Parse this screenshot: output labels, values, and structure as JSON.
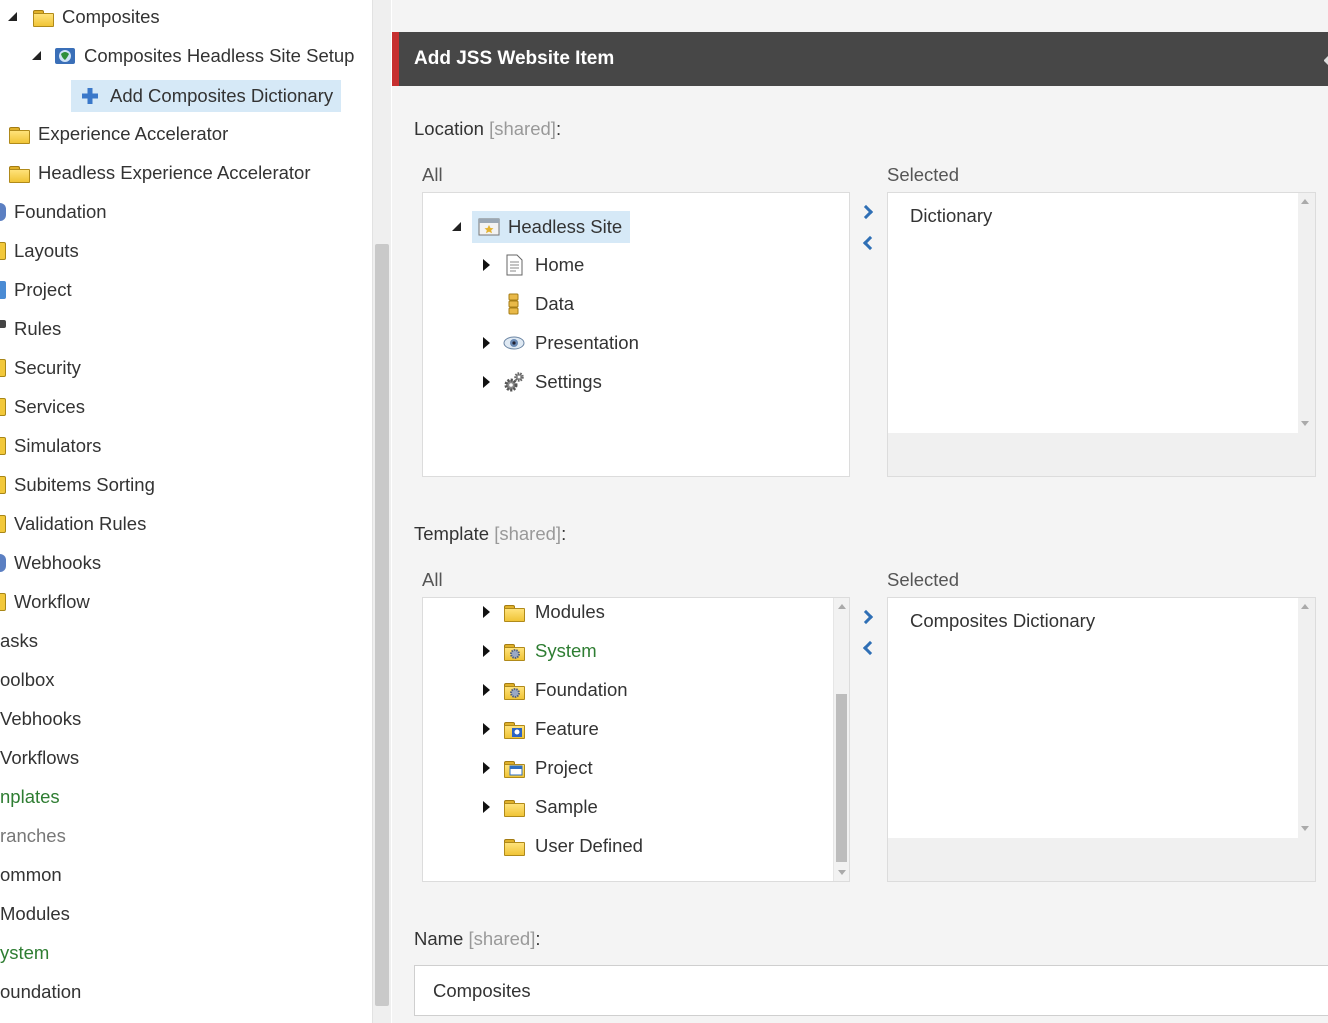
{
  "left_tree": {
    "items": [
      {
        "label": "Composites"
      },
      {
        "label": "Composites Headless Site Setup"
      },
      {
        "label": "Add Composites Dictionary"
      },
      {
        "label": "Experience Accelerator"
      },
      {
        "label": "Headless Experience Accelerator"
      },
      {
        "label": "Foundation"
      },
      {
        "label": "Layouts"
      },
      {
        "label": "Project"
      },
      {
        "label": "Rules"
      },
      {
        "label": "Security"
      },
      {
        "label": "Services"
      },
      {
        "label": "Simulators"
      },
      {
        "label": "Subitems Sorting"
      },
      {
        "label": "Validation Rules"
      },
      {
        "label": "Webhooks"
      },
      {
        "label": "Workflow"
      },
      {
        "label": "asks"
      },
      {
        "label": "oolbox"
      },
      {
        "label": "Vebhooks"
      },
      {
        "label": "Vorkflows"
      },
      {
        "label": "nplates"
      },
      {
        "label": "ranches"
      },
      {
        "label": "ommon"
      },
      {
        "label": "Modules"
      },
      {
        "label": "ystem"
      },
      {
        "label": "oundation"
      }
    ]
  },
  "dialog": {
    "title": "Add JSS Website Item",
    "location": {
      "label": "Location",
      "shared": "[shared]",
      "colon": ":",
      "all_label": "All",
      "selected_label": "Selected",
      "tree": [
        {
          "label": "Headless Site",
          "icon": "site-icon"
        },
        {
          "label": "Home",
          "icon": "page-icon"
        },
        {
          "label": "Data",
          "icon": "data-icon"
        },
        {
          "label": "Presentation",
          "icon": "eye-icon"
        },
        {
          "label": "Settings",
          "icon": "gears-icon"
        }
      ],
      "selected": [
        "Dictionary"
      ]
    },
    "template": {
      "label": "Template",
      "shared": "[shared]",
      "colon": ":",
      "all_label": "All",
      "selected_label": "Selected",
      "tree": [
        {
          "label": "Modules",
          "icon": "folder-icon"
        },
        {
          "label": "System",
          "icon": "folder-gear-icon"
        },
        {
          "label": "Foundation",
          "icon": "folder-gear-icon"
        },
        {
          "label": "Feature",
          "icon": "folder-blue-icon"
        },
        {
          "label": "Project",
          "icon": "folder-window-icon"
        },
        {
          "label": "Sample",
          "icon": "folder-icon"
        },
        {
          "label": "User Defined",
          "icon": "folder-icon"
        }
      ],
      "selected": [
        "Composites Dictionary"
      ]
    },
    "name": {
      "label": "Name",
      "shared": "[shared]",
      "colon": ":",
      "value": "Composites"
    }
  },
  "colors": {
    "header_bg": "#474747",
    "header_accent": "#c62f2f",
    "selection_bg": "#d6e9f7",
    "green_text": "#2e7d32",
    "arrow_blue": "#2f6fb5"
  }
}
